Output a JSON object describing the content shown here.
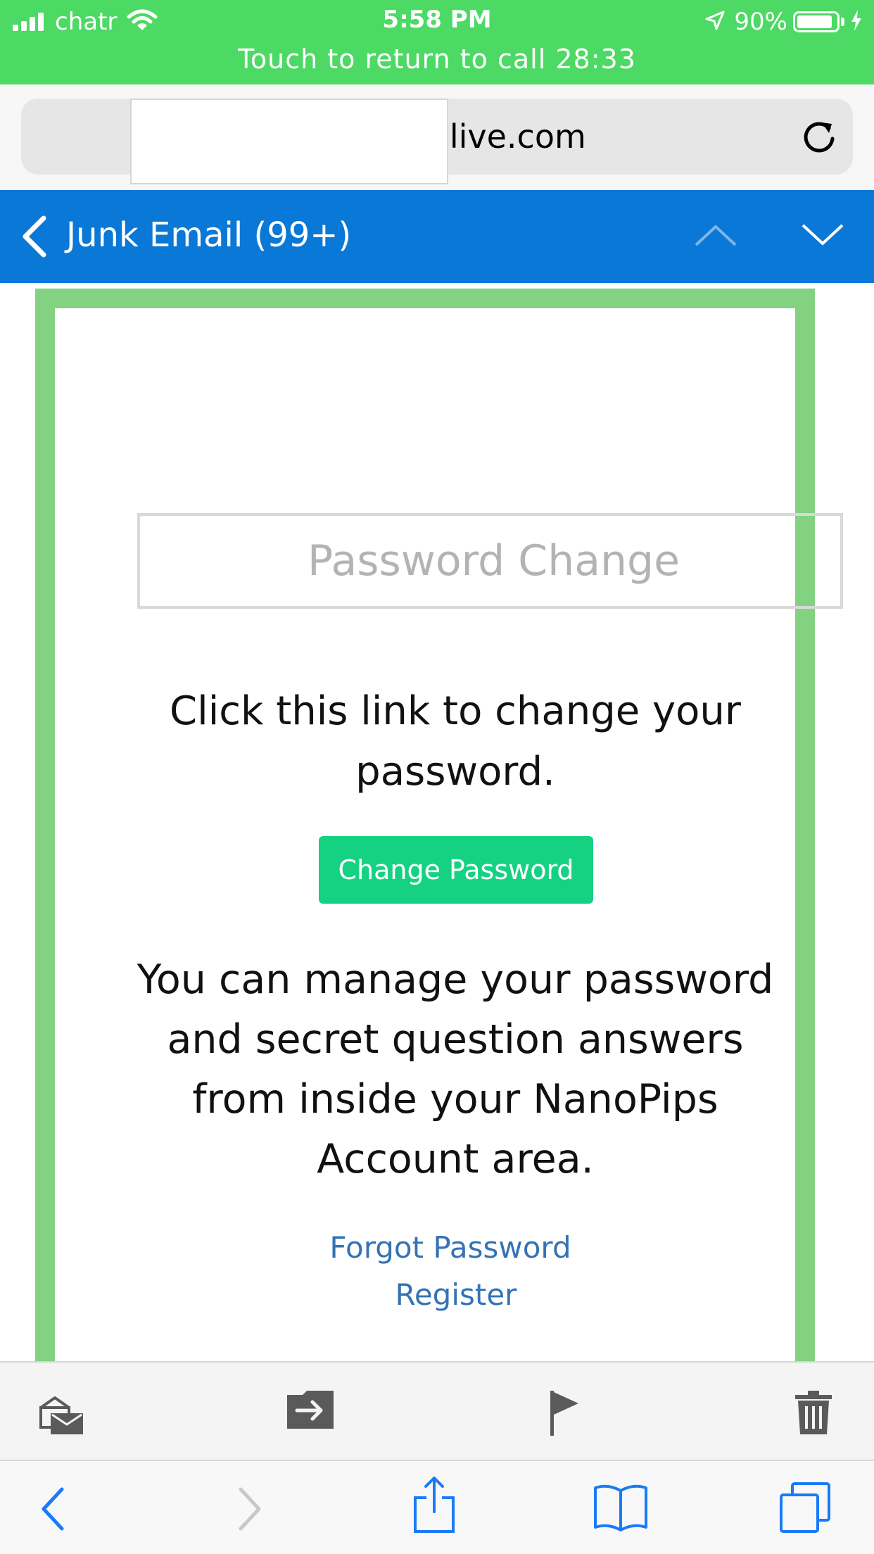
{
  "status_bar": {
    "carrier": "chatr",
    "time": "5:58 PM",
    "battery": "90%",
    "battery_level": 0.9,
    "call_banner": "Touch to return to call 28:33",
    "icons": [
      "signal-icon",
      "wifi-icon",
      "location-icon",
      "battery-icon",
      "charging-icon"
    ]
  },
  "browser": {
    "url": "outlook.live.com",
    "icons": [
      "lock-icon",
      "reload-icon"
    ]
  },
  "mail_header": {
    "folder": "Junk Email (99+)",
    "icons": [
      "back-chevron-icon",
      "chevron-up-icon",
      "chevron-down-icon"
    ]
  },
  "email": {
    "header_text": "Password Change",
    "instruction": "Click this link to change your password.",
    "button_label": "Change Password",
    "manage_text": "You can manage your password and secret question answers from inside your NanoPips Account area.",
    "forgot_link": "Forgot Password",
    "register_link": "Register",
    "colors": {
      "frame": "#82d282",
      "button": "#15d283",
      "link": "#3473b4"
    }
  },
  "mail_toolbar": {
    "icons": [
      "mark-read-icon",
      "move-folder-icon",
      "flag-icon",
      "trash-icon"
    ]
  },
  "safari_toolbar": {
    "icons": [
      "back-arrow-icon",
      "forward-arrow-icon",
      "share-icon",
      "bookmarks-icon",
      "tabs-icon"
    ]
  },
  "colors": {
    "status_bar": "#4cd964",
    "outlook_blue": "#0a78d7",
    "ios_blue": "#1a7af8"
  }
}
